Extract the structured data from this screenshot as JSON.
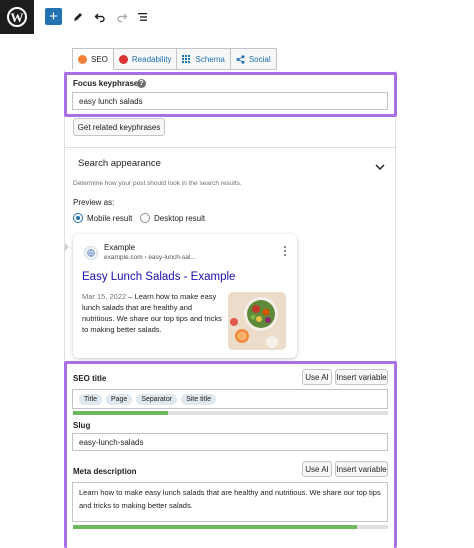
{
  "toolbar": {
    "add_label": "+"
  },
  "tabs": [
    {
      "label": "SEO"
    },
    {
      "label": "Readability"
    },
    {
      "label": "Schema"
    },
    {
      "label": "Social"
    }
  ],
  "focus": {
    "label": "Focus keyphrase",
    "help": "?",
    "value": "easy lunch salads",
    "related_button": "Get related keyphrases"
  },
  "search_appearance": {
    "title": "Search appearance",
    "description": "Determine how your post should look in the search results.",
    "preview_label": "Preview as:",
    "mobile_label": "Mobile result",
    "desktop_label": "Desktop result",
    "selected": "mobile"
  },
  "preview": {
    "site_name": "Example",
    "url": "example.com › easy-lunch-sal...",
    "title": "Easy Lunch Salads - Example",
    "date": "Mar 15, 2022",
    "separator": "–",
    "snippet": "Learn how to make easy lunch salads that are healthy and nutritious. We share our top tips and tricks to making better salads."
  },
  "seo_title": {
    "label": "SEO title",
    "use_ai": "Use AI",
    "insert_variable": "Insert variable",
    "chips": [
      "Title",
      "Page",
      "Separator",
      "Site title"
    ],
    "progress": 0.3
  },
  "slug": {
    "label": "Slug",
    "value": "easy-lunch-salads"
  },
  "meta": {
    "label": "Meta description",
    "use_ai": "Use AI",
    "insert_variable": "Insert variable",
    "value": "Learn how to make easy lunch salads that are healthy and nutritious. We share our top tips and tricks to making better salads.",
    "progress": 0.9
  },
  "colors": {
    "accent": "#2271b1",
    "highlight": "#a970e6",
    "progress_good": "#6cba5d",
    "google_link": "#1a0dab"
  }
}
